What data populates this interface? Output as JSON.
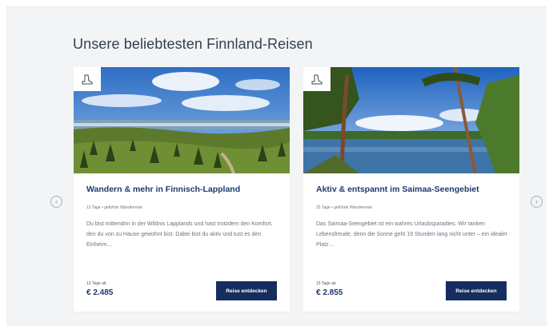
{
  "section": {
    "title": "Unsere beliebtesten Finnland-Reisen"
  },
  "cards": [
    {
      "title": "Wandern & mehr in Finnisch-Lappland",
      "meta": "13 Tage • geführte Wanderreise",
      "description": "Du bist mittendrin in der Wildnis Lapplands und hast trotzdem den Komfort, den du von zu Hause gewohnt bist. Dabei bist du aktiv und tust es den Einheim…",
      "price_label": "13 Tage ab",
      "price": "€ 2.485",
      "cta_label": "Reise entdecken",
      "badge_icon": "hiking-boot-icon"
    },
    {
      "title": "Aktiv & entspannt im Saimaa-Seengebiet",
      "meta": "15 Tage • geführte Wanderreise",
      "description": "Das Saimaa-Seengebiet ist ein wahres Urlaubsparadies. Wir tanken Lebensfreude, denn die Sonne geht 19 Stunden lang nicht unter – ein idealer Platz…",
      "price_label": "15 Tage ab",
      "price": "€ 2.855",
      "cta_label": "Reise entdecken",
      "badge_icon": "hiking-boot-icon"
    }
  ],
  "carousel": {
    "prev_icon": "chevron-left-circle-icon",
    "next_icon": "chevron-right-circle-icon"
  },
  "colors": {
    "accent": "#142e5f",
    "title": "#1f3a6e",
    "background": "#f3f4f6"
  }
}
